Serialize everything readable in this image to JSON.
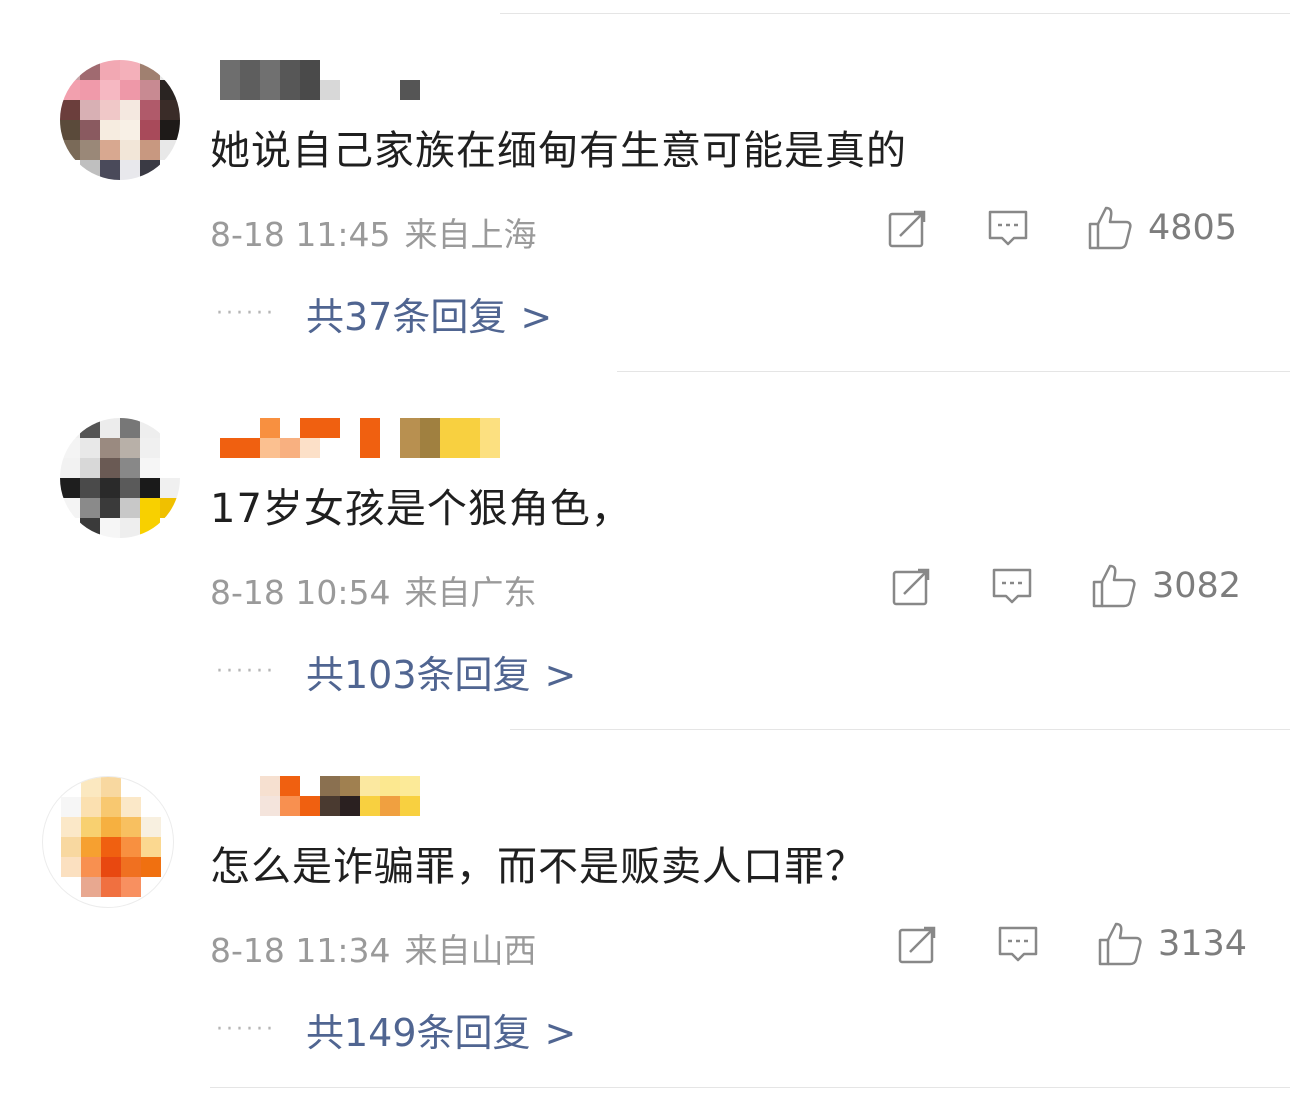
{
  "comments": [
    {
      "text": "她说自己家族在缅甸有生意可能是真的",
      "time": "8-18 11:45",
      "location": "来自上海",
      "likes": "4805",
      "replies_label": "共37条回复",
      "chevron": ">"
    },
    {
      "text": "17岁女孩是个狠角色，",
      "time": "8-18 10:54",
      "location": "来自广东",
      "likes": "3082",
      "replies_label": "共103条回复",
      "chevron": ">"
    },
    {
      "text": "怎么是诈骗罪，而不是贩卖人口罪？",
      "time": "8-18 11:34",
      "location": "来自山西",
      "likes": "3134",
      "replies_label": "共149条回复",
      "chevron": ">"
    }
  ],
  "reply_dots": "······",
  "icons": {
    "share": "share-icon",
    "comment": "comment-icon",
    "like": "thumbs-up-icon"
  },
  "colors": {
    "text": "#1f1f1f",
    "meta": "#9a9a9a",
    "link": "#506591",
    "divider": "#e5e5e5"
  }
}
